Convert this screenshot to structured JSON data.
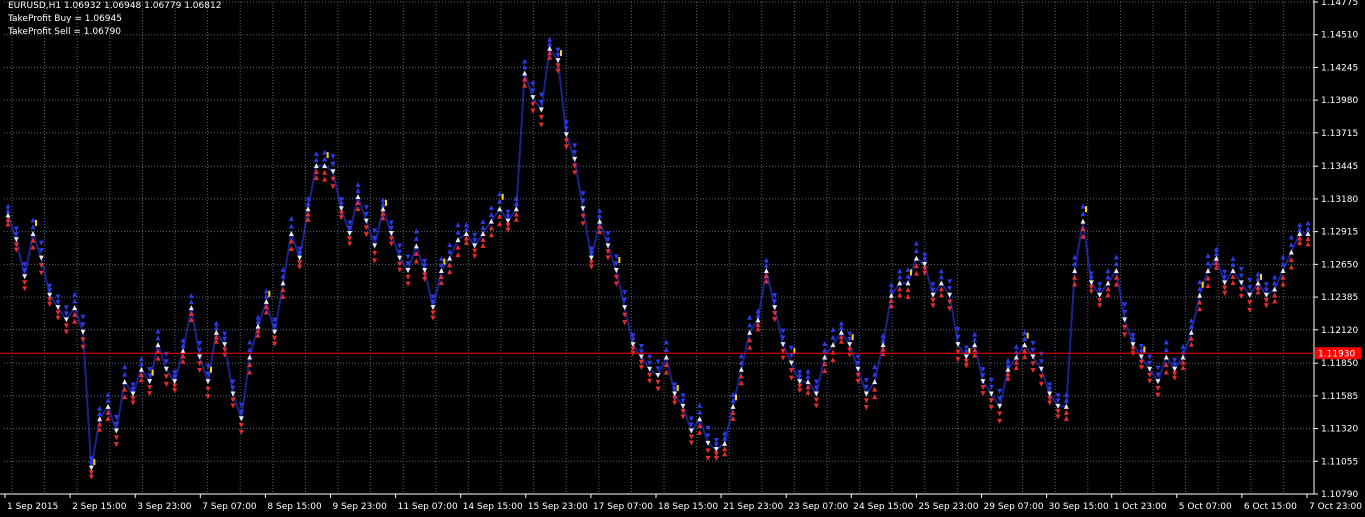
{
  "header": {
    "symbol_line": "EURUSD,H1  1.06932 1.06948 1.06779 1.06812",
    "tp_buy": "TakeProfit Buy = 1.06945",
    "tp_sell": "TakeProfit Sell = 1.06790"
  },
  "colors": {
    "background": "#000000",
    "grid": "#5a6a78",
    "axis": "#ffffff",
    "price_line": "#ff0000",
    "price_label_bg": "#ff0000",
    "up_arrow": "#3040ff",
    "down_arrow": "#ff3030",
    "neutral_arrow": "#ffffff",
    "highlight": "#ffd800"
  },
  "price_axis": {
    "ticks": [
      "1.14775",
      "1.14510",
      "1.14245",
      "1.13980",
      "1.13715",
      "1.13445",
      "1.13180",
      "1.12915",
      "1.12650",
      "1.12385",
      "1.12120",
      "1.11850",
      "1.11585",
      "1.11320",
      "1.11055",
      "1.10790"
    ],
    "current_price": "1.11930"
  },
  "time_axis": {
    "labels": [
      "1 Sep 2015",
      "2 Sep 15:00",
      "3 Sep 23:00",
      "7 Sep 07:00",
      "8 Sep 15:00",
      "9 Sep 23:00",
      "11 Sep 07:00",
      "14 Sep 15:00",
      "15 Sep 23:00",
      "17 Sep 07:00",
      "18 Sep 15:00",
      "21 Sep 23:00",
      "23 Sep 07:00",
      "24 Sep 15:00",
      "25 Sep 23:00",
      "29 Sep 07:00",
      "30 Sep 15:00",
      "1 Oct 23:00",
      "5 Oct 07:00",
      "6 Oct 15:00",
      "7 Oct 23:00"
    ]
  },
  "chart_data": {
    "type": "line",
    "title": "EURUSD,H1",
    "ylim": [
      1.1079,
      1.14775
    ],
    "x": [
      "1 Sep 2015",
      "2 Sep 15:00",
      "3 Sep 23:00",
      "7 Sep 07:00",
      "8 Sep 15:00",
      "9 Sep 23:00",
      "11 Sep 07:00",
      "14 Sep 15:00",
      "15 Sep 23:00",
      "17 Sep 07:00",
      "18 Sep 15:00",
      "21 Sep 23:00",
      "23 Sep 07:00",
      "24 Sep 15:00",
      "25 Sep 23:00",
      "29 Sep 07:00",
      "30 Sep 15:00",
      "1 Oct 23:00",
      "5 Oct 07:00",
      "6 Oct 15:00",
      "7 Oct 23:00"
    ],
    "series": [
      {
        "values": [
          1.1305,
          1.1285,
          1.1255,
          1.129,
          1.127,
          1.124,
          1.123,
          1.122,
          1.123,
          1.121,
          1.11,
          1.114,
          1.115,
          1.113,
          1.117,
          1.116,
          1.118,
          1.117,
          1.12,
          1.118,
          1.117,
          1.1195,
          1.123,
          1.119,
          1.117,
          1.121,
          1.12,
          1.116,
          1.114,
          1.119,
          1.1215,
          1.1235,
          1.121,
          1.125,
          1.129,
          1.127,
          1.131,
          1.1345,
          1.1345,
          1.134,
          1.131,
          1.129,
          1.132,
          1.13,
          1.128,
          1.131,
          1.129,
          1.127,
          1.126,
          1.128,
          1.126,
          1.123,
          1.126,
          1.127,
          1.1285,
          1.129,
          1.128,
          1.129,
          1.13,
          1.131,
          1.13,
          1.131,
          1.142,
          1.14,
          1.139,
          1.144,
          1.143,
          1.137,
          1.135,
          1.131,
          1.127,
          1.13,
          1.128,
          1.126,
          1.123,
          1.12,
          1.119,
          1.118,
          1.1175,
          1.119,
          1.116,
          1.115,
          1.113,
          1.114,
          1.112,
          1.1115,
          1.112,
          1.115,
          1.118,
          1.121,
          1.122,
          1.126,
          1.123,
          1.12,
          1.1185,
          1.117,
          1.117,
          1.116,
          1.119,
          1.12,
          1.121,
          1.12,
          1.118,
          1.116,
          1.117,
          1.12,
          1.124,
          1.125,
          1.125,
          1.127,
          1.1265,
          1.124,
          1.125,
          1.124,
          1.12,
          1.119,
          1.12,
          1.117,
          1.116,
          1.115,
          1.118,
          1.119,
          1.12,
          1.119,
          1.118,
          1.116,
          1.115,
          1.115,
          1.126,
          1.13,
          1.125,
          1.124,
          1.125,
          1.126,
          1.122,
          1.12,
          1.119,
          1.118,
          1.117,
          1.119,
          1.118,
          1.119,
          1.121,
          1.124,
          1.126,
          1.127,
          1.125,
          1.126,
          1.125,
          1.124,
          1.125,
          1.124,
          1.1245,
          1.126,
          1.1275,
          1.129,
          1.129
        ]
      }
    ]
  }
}
